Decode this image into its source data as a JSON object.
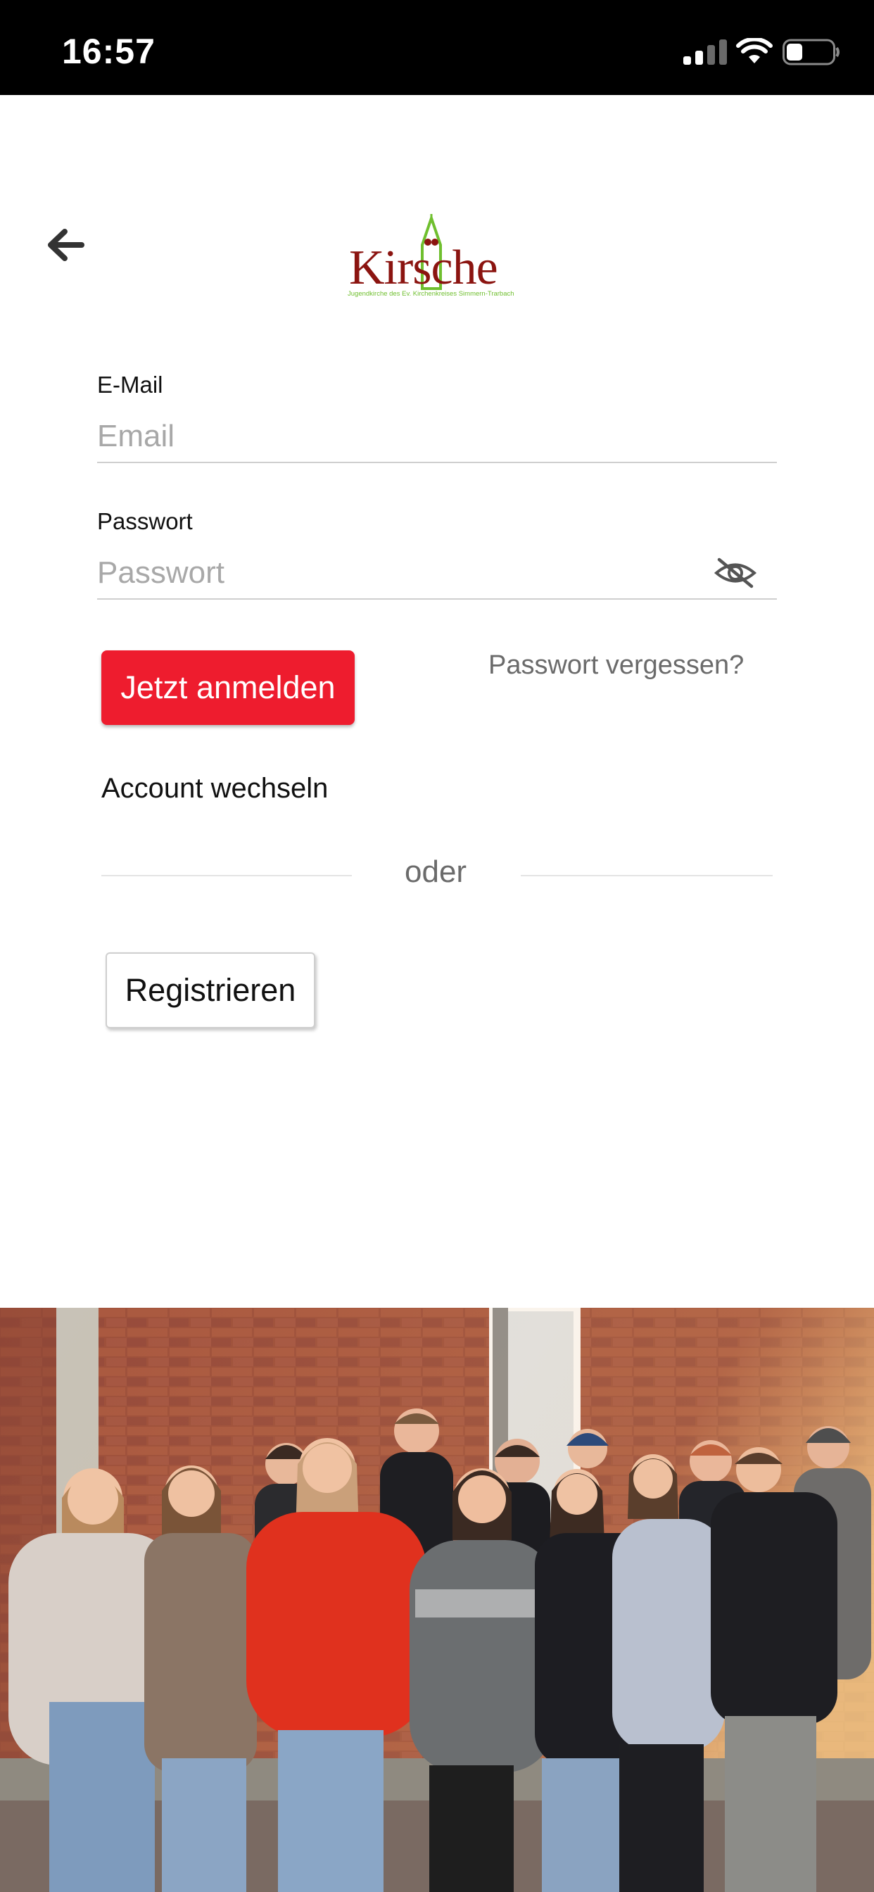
{
  "status_bar": {
    "time": "16:57",
    "icons": [
      "signal-icon",
      "wifi-icon",
      "battery-icon"
    ],
    "battery_level": 0.35
  },
  "header": {
    "back_icon": "arrow-left-icon",
    "logo": {
      "name": "Kirsche",
      "subtitle": "Jugendkirche des Ev. Kirchenkreises Simmern-Trarbach",
      "colors": {
        "text": "#8b1410",
        "accent": "#6fbf2e"
      }
    }
  },
  "form": {
    "email": {
      "label": "E-Mail",
      "placeholder": "Email",
      "value": ""
    },
    "password": {
      "label": "Passwort",
      "placeholder": "Passwort",
      "value": "",
      "toggle_icon": "eye-slash-icon"
    },
    "login_button": "Jetzt anmelden",
    "forgot_link": "Passwort vergessen?",
    "switch_account": "Account wechseln",
    "divider": "oder",
    "register_button": "Registrieren"
  },
  "colors": {
    "primary": "#ee1c2e",
    "status_bar": "#000000",
    "muted_text": "#6b6b6b",
    "placeholder": "#a8a8a8"
  }
}
